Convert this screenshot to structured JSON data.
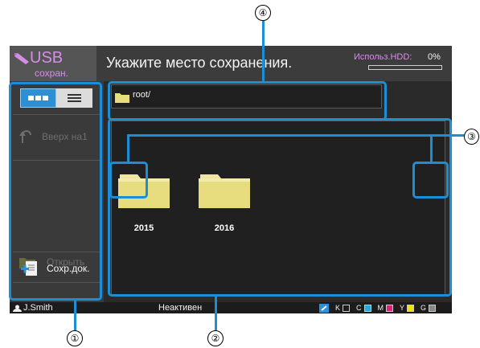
{
  "header": {
    "app_title": "USB",
    "app_subtitle": "сохран.",
    "instruction": "Укажите место сохранения.",
    "hdd_label": "Использ.HDD:",
    "hdd_value": "0%",
    "hdd_fill": 0
  },
  "sidebar": {
    "view_grid_icon": "grid-icon",
    "view_list_icon": "list-icon",
    "up_label": "Вверх на1",
    "open_label": "Открыть",
    "save_label": "Сохр.док."
  },
  "path": {
    "text": "root/",
    "icon": "folder-icon"
  },
  "folders": [
    {
      "name": "2015",
      "icon": "folder-icon"
    },
    {
      "name": "2016",
      "icon": "folder-icon"
    }
  ],
  "status_bar": {
    "user": "J.Smith",
    "status": "Неактивен",
    "inks": [
      {
        "label": "K",
        "color": "#222222"
      },
      {
        "label": "C",
        "color": "#29a8e0"
      },
      {
        "label": "M",
        "color": "#e0207a"
      },
      {
        "label": "Y",
        "color": "#f5e000"
      },
      {
        "label": "G",
        "color": "#888888"
      }
    ]
  },
  "callouts": [
    "①",
    "②",
    "③",
    "④"
  ],
  "colors": {
    "accent": "#d58ee7",
    "highlight": "#1a8fd8",
    "selected_toggle": "#2f8fd3",
    "folder": "#e7dd7e"
  }
}
